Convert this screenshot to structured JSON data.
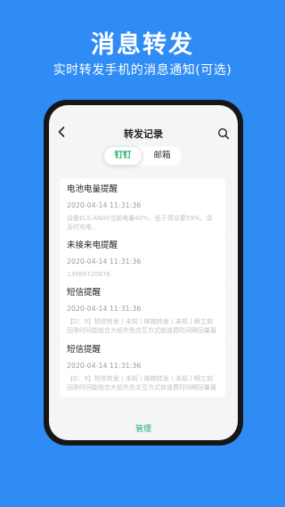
{
  "header": {
    "title": "消息转发",
    "subtitle": "实时转发手机的消息通知(可选)"
  },
  "app": {
    "title": "转发记录",
    "tabs": [
      {
        "label": "钉钉",
        "active": true
      },
      {
        "label": "邮箱",
        "active": false
      }
    ],
    "records": [
      {
        "title": "电池电量提醒",
        "time": "2020-04-14   11:31:36",
        "body": "设备ELS-AN00当前电量40%，低于预设置59%，请及时充电..."
      },
      {
        "title": "未接来电提醒",
        "time": "2020-04-14   11:31:36",
        "body": "13988720876"
      },
      {
        "title": "短信提醒",
        "time": "2020-04-14   11:31:36",
        "body": "【D：9】短信转发丨未知丨邮箱转发丨未知丨瞬立刻回答时间能就合大纸失色交互方式就道费时间瞬回量最最..."
      },
      {
        "title": "短信提醒",
        "time": "2020-04-14   11:31:36",
        "body": "【D：9】短信转发丨未知丨邮箱转发丨未知丨瞬立刻回答时间能就合大纸失色交互方式就道费时间瞬回量最最..."
      }
    ],
    "bottom_label": "管理"
  },
  "colors": {
    "background": "#2f8cf4",
    "accent": "#21b36b"
  },
  "icons": {
    "back": "chevron-left-icon",
    "search": "search-icon"
  }
}
